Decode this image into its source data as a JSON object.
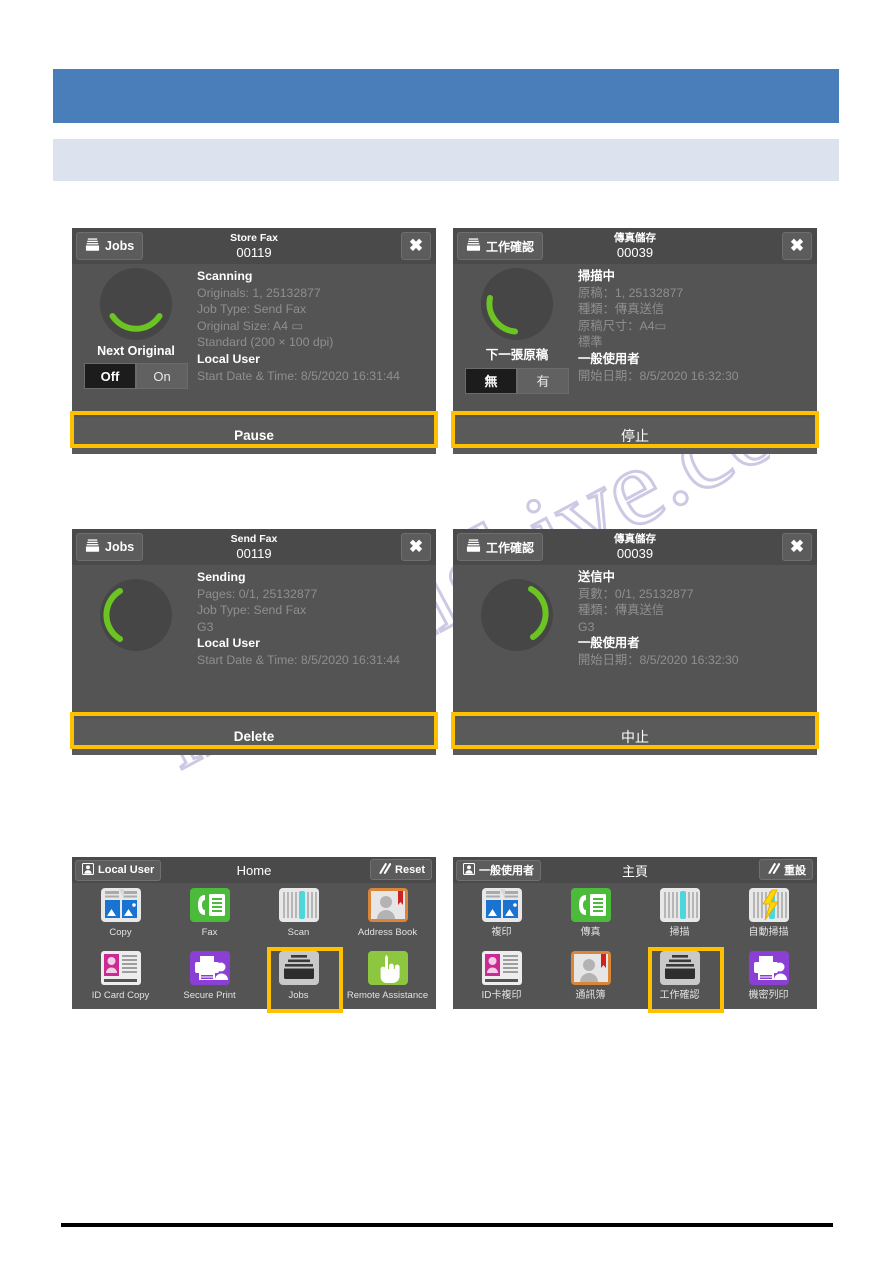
{
  "page": {
    "header_blue_color": "#4a7ebb",
    "header_light_color": "#dce3ef",
    "highlight_color": "#ffc000",
    "watermark_text": "manualshive.com"
  },
  "panels": {
    "store_fax_en": {
      "chip_label": "Jobs",
      "chip_icon": "jobs-tray-icon",
      "title_line1": "Store Fax",
      "title_line2": "00119",
      "close_icon": "close-icon",
      "spinner_label": "Next Original",
      "toggle": {
        "selected": "Off",
        "unselected": "On"
      },
      "info": [
        {
          "text": "Scanning",
          "strong": true
        },
        {
          "text": "Originals: 1, 25132877",
          "strong": false
        },
        {
          "text": "Job Type: Send Fax",
          "strong": false
        },
        {
          "text": "Original Size: A4 ▭",
          "strong": false
        },
        {
          "text": "Standard (200 × 100 dpi)",
          "strong": false
        },
        {
          "text": "Local User",
          "strong": true
        },
        {
          "text": "Start Date & Time: 8/5/2020 16:31:44",
          "strong": false
        }
      ],
      "action_label": "Pause"
    },
    "store_fax_zh": {
      "chip_label": "工作確認",
      "chip_icon": "jobs-tray-icon",
      "title_line1": "傳真儲存",
      "title_line2": "00039",
      "close_icon": "close-icon",
      "spinner_label": "下一張原稿",
      "toggle": {
        "selected": "無",
        "unselected": "有"
      },
      "info": [
        {
          "text": "掃描中",
          "strong": true
        },
        {
          "text": "原稿：1, 25132877",
          "strong": false
        },
        {
          "text": "種類：傳真送信",
          "strong": false
        },
        {
          "text": "原稿尺寸：A4▭",
          "strong": false
        },
        {
          "text": "標準",
          "strong": false
        },
        {
          "text": "一般使用者",
          "strong": true
        },
        {
          "text": "開始日期：8/5/2020 16:32:30",
          "strong": false
        }
      ],
      "action_label": "停止"
    },
    "send_fax_en": {
      "chip_label": "Jobs",
      "chip_icon": "jobs-tray-icon",
      "title_line1": "Send Fax",
      "title_line2": "00119",
      "close_icon": "close-icon",
      "info": [
        {
          "text": "Sending",
          "strong": true
        },
        {
          "text": "Pages: 0/1, 25132877",
          "strong": false
        },
        {
          "text": "Job Type: Send Fax",
          "strong": false
        },
        {
          "text": "G3",
          "strong": false
        },
        {
          "text": "Local User",
          "strong": true
        },
        {
          "text": "Start Date & Time: 8/5/2020 16:31:44",
          "strong": false
        }
      ],
      "action_label": "Delete"
    },
    "send_fax_zh": {
      "chip_label": "工作確認",
      "chip_icon": "jobs-tray-icon",
      "title_line1": "傳真儲存",
      "title_line2": "00039",
      "close_icon": "close-icon",
      "info": [
        {
          "text": "送信中",
          "strong": true
        },
        {
          "text": "頁數：0/1, 25132877",
          "strong": false
        },
        {
          "text": "種類：傳真送信",
          "strong": false
        },
        {
          "text": "G3",
          "strong": false
        },
        {
          "text": "一般使用者",
          "strong": true
        },
        {
          "text": "開始日期：8/5/2020 16:32:30",
          "strong": false
        }
      ],
      "action_label": "中止"
    },
    "home_en": {
      "user_chip": "Local User",
      "user_icon": "user-icon",
      "title": "Home",
      "reset_label": "Reset",
      "reset_icon": "reset-slashes-icon",
      "apps": [
        {
          "label": "Copy",
          "icon": "copy-icon"
        },
        {
          "label": "Fax",
          "icon": "fax-icon"
        },
        {
          "label": "Scan",
          "icon": "scan-icon"
        },
        {
          "label": "Address Book",
          "icon": "address-book-icon"
        },
        {
          "label": "ID Card Copy",
          "icon": "id-card-copy-icon"
        },
        {
          "label": "Secure Print",
          "icon": "secure-print-icon"
        },
        {
          "label": "Jobs",
          "icon": "jobs-tray-icon"
        },
        {
          "label": "Remote Assistance",
          "icon": "remote-assistance-icon"
        }
      ],
      "highlighted_app": "Jobs"
    },
    "home_zh": {
      "user_chip": "一般使用者",
      "user_icon": "user-icon",
      "title": "主頁",
      "reset_label": "重設",
      "reset_icon": "reset-slashes-icon",
      "apps": [
        {
          "label": "複印",
          "icon": "copy-icon"
        },
        {
          "label": "傳真",
          "icon": "fax-icon"
        },
        {
          "label": "掃描",
          "icon": "scan-icon"
        },
        {
          "label": "自動掃描",
          "icon": "auto-scan-icon"
        },
        {
          "label": "ID卡複印",
          "icon": "id-card-copy-icon"
        },
        {
          "label": "通訊簿",
          "icon": "address-book-icon"
        },
        {
          "label": "工作確認",
          "icon": "jobs-tray-icon"
        },
        {
          "label": "機密列印",
          "icon": "secure-print-icon"
        }
      ],
      "highlighted_app": "工作確認"
    }
  }
}
